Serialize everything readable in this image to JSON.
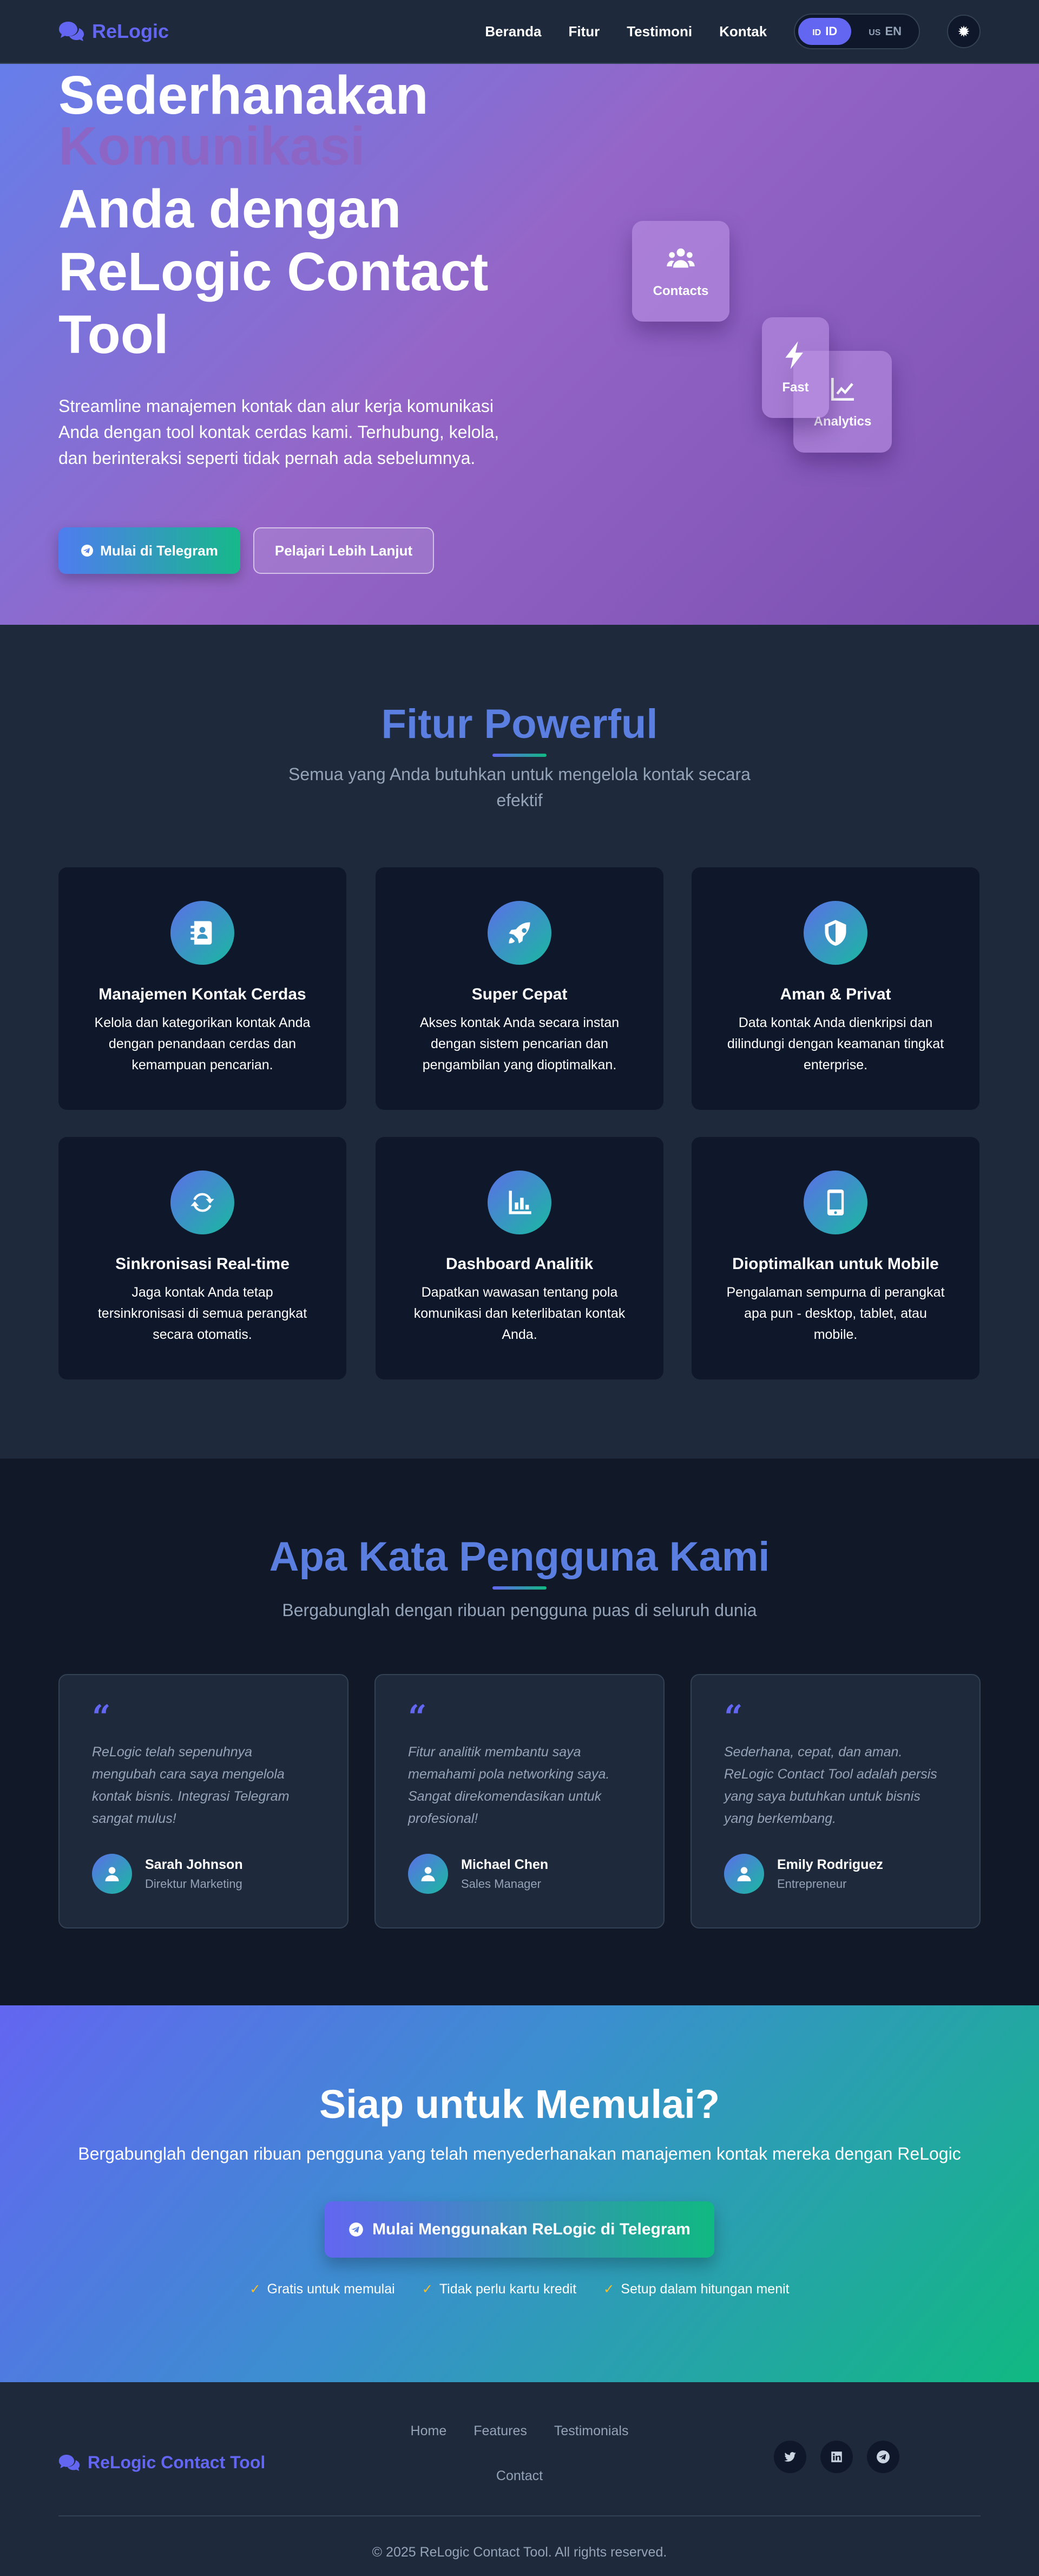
{
  "nav": {
    "brand": "ReLogic",
    "links": [
      "Beranda",
      "Fitur",
      "Testimoni",
      "Kontak"
    ],
    "lang_id_flag": "ID",
    "lang_id": "ID",
    "lang_en_flag": "US",
    "lang_en": "EN",
    "theme_icon": "gear-icon"
  },
  "hero": {
    "title_line1": "Sederhanakan",
    "title_line2": "Komunikasi",
    "title_rest": "Anda dengan ReLogic Contact Tool",
    "subtitle": "Streamline manajemen kontak dan alur kerja komunikasi Anda dengan tool kontak cerdas kami. Terhubung, kelola, dan berinteraksi seperti tidak pernah ada sebelumnya.",
    "primary_button": "Mulai di Telegram",
    "secondary_button": "Pelajari Lebih Lanjut",
    "cards": [
      "Contacts",
      "Fast",
      "Analytics"
    ]
  },
  "features": {
    "title": "Fitur Powerful",
    "subtitle": "Semua yang Anda butuhkan untuk mengelola kontak secara efektif",
    "items": [
      {
        "title": "Manajemen Kontak Cerdas",
        "desc": "Kelola dan kategorikan kontak Anda dengan penandaan cerdas dan kemampuan pencarian.",
        "icon": "address-book-icon"
      },
      {
        "title": "Super Cepat",
        "desc": "Akses kontak Anda secara instan dengan sistem pencarian dan pengambilan yang dioptimalkan.",
        "icon": "rocket-icon"
      },
      {
        "title": "Aman & Privat",
        "desc": "Data kontak Anda dienkripsi dan dilindungi dengan keamanan tingkat enterprise.",
        "icon": "shield-icon"
      },
      {
        "title": "Sinkronisasi Real-time",
        "desc": "Jaga kontak Anda tetap tersinkronisasi di semua perangkat secara otomatis.",
        "icon": "sync-icon"
      },
      {
        "title": "Dashboard Analitik",
        "desc": "Dapatkan wawasan tentang pola komunikasi dan keterlibatan kontak Anda.",
        "icon": "chart-icon"
      },
      {
        "title": "Dioptimalkan untuk Mobile",
        "desc": "Pengalaman sempurna di perangkat apa pun - desktop, tablet, atau mobile.",
        "icon": "mobile-icon"
      }
    ]
  },
  "testimonials": {
    "title": "Apa Kata Pengguna Kami",
    "subtitle": "Bergabunglah dengan ribuan pengguna puas di seluruh dunia",
    "items": [
      {
        "quote": "ReLogic telah sepenuhnya mengubah cara saya mengelola kontak bisnis. Integrasi Telegram sangat mulus!",
        "name": "Sarah Johnson",
        "role": "Direktur Marketing"
      },
      {
        "quote": "Fitur analitik membantu saya memahami pola networking saya. Sangat direkomendasikan untuk profesional!",
        "name": "Michael Chen",
        "role": "Sales Manager"
      },
      {
        "quote": "Sederhana, cepat, dan aman. ReLogic Contact Tool adalah persis yang saya butuhkan untuk bisnis yang berkembang.",
        "name": "Emily Rodriguez",
        "role": "Entrepreneur"
      }
    ]
  },
  "cta": {
    "title": "Siap untuk Memulai?",
    "subtitle": "Bergabunglah dengan ribuan pengguna yang telah menyederhanakan manajemen kontak mereka dengan ReLogic",
    "button": "Mulai Menggunakan ReLogic di Telegram",
    "checks": [
      "Gratis untuk memulai",
      "Tidak perlu kartu kredit",
      "Setup dalam hitungan menit"
    ]
  },
  "footer": {
    "brand": "ReLogic Contact Tool",
    "links": [
      "Home",
      "Features",
      "Testimonials",
      "Contact"
    ],
    "socials": [
      "twitter-icon",
      "linkedin-icon",
      "telegram-icon"
    ],
    "copyright": "© 2025 ReLogic Contact Tool. All rights reserved."
  },
  "colors": {
    "accent": "#6366f1",
    "green": "#10b981",
    "dark_bg": "#1e293b",
    "card_bg": "#0f172a"
  }
}
